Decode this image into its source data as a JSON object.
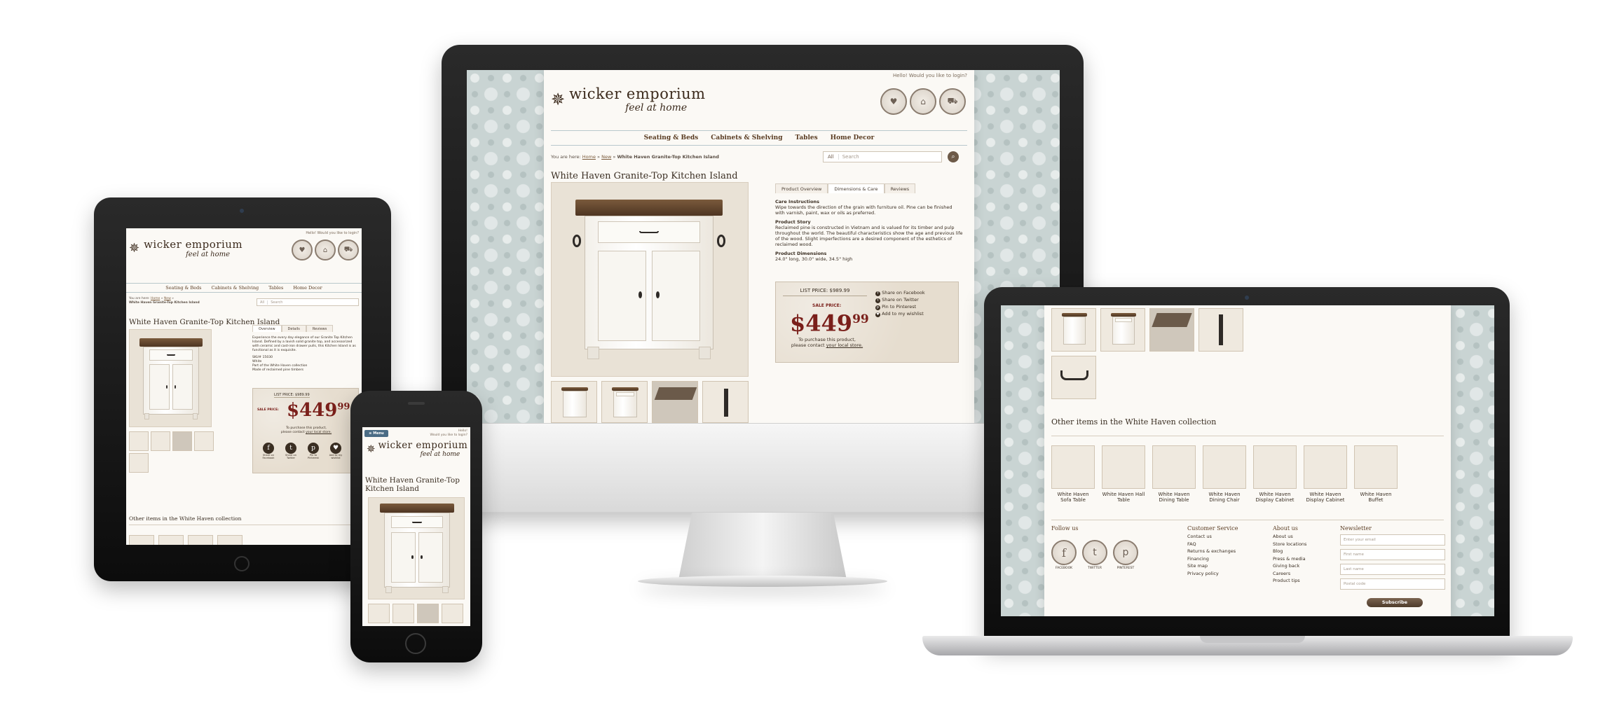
{
  "brand": {
    "name": "wicker emporium",
    "tagline": "feel at home",
    "greeting": "Hello! Would you like to login?"
  },
  "nav": [
    "Seating & Beds",
    "Cabinets & Shelving",
    "Tables",
    "Home Decor"
  ],
  "phone_menu_label": "Menu",
  "phone_greeting_line1": "Hello!",
  "phone_greeting_line2": "Would you like to login?",
  "breadcrumb": {
    "prefix": "You are here:",
    "home": "Home",
    "sep": "»",
    "new": "New",
    "current": "White Haven Granite-Top Kitchen Island"
  },
  "search": {
    "scope": "All",
    "placeholder": "Search"
  },
  "product": {
    "title": "White Haven Granite-Top Kitchen Island",
    "tabs": [
      "Product Overview",
      "Dimensions & Care",
      "Reviews"
    ],
    "tablet_tabs": [
      "Overview",
      "Details",
      "Reviews"
    ],
    "care_heading": "Care Instructions",
    "care_text": "Wipe towards the direction of the grain with furniture oil. Pine can be finished with varnish, paint, wax or oils as preferred.",
    "story_heading": "Product Story",
    "story_text": "Reclaimed pine is constructed in Vietnam and is valued for its timber and pulp throughout the world. The beautiful characteristics show the age and previous life of the wood. Slight imperfections are a desired component of the esthetics of reclaimed wood.",
    "dims_heading": "Product Dimensions",
    "dims_text": "24.0\" long, 30.0\" wide, 34.5\" high",
    "overview_text": "Experience the every day elegance of our Granite Top Kitchen Island. Defined by a lavish solid granite top, and accessorized with ceramic and cast-iron drawer pulls, this Kitchen Island is as functional as it is exquisite.",
    "sku": "SKU# 15030",
    "color": "White",
    "collection_note": "Part of the White Haven collection",
    "material": "Made of reclaimed pine timbers",
    "list_price_label": "LIST PRICE:",
    "list_price": "$989.99",
    "sale_label": "SALE PRICE:",
    "sale_dollars": "$449",
    "sale_cents": "99",
    "contact_line1": "To purchase this product,",
    "contact_line2": "please contact",
    "contact_link": "your local store.",
    "share": [
      "Share on Facebook",
      "Share on Twitter",
      "Pin to Pinterest",
      "Add to my wishlist"
    ],
    "share_short": [
      "Share on Facebook",
      "Share on Twitter",
      "Pin to Pinterest",
      "Add to my wishlist"
    ]
  },
  "collection": {
    "heading": "Other items in the White Haven collection",
    "items": [
      "White Haven Sofa Table",
      "White Haven Hall Table",
      "White Haven Dining Table",
      "White Haven Dining Chair",
      "White Haven Display Cabinet",
      "White Haven Display Cabinet",
      "White Haven Buffet"
    ]
  },
  "footer": {
    "follow_heading": "Follow us",
    "social": [
      "FACEBOOK",
      "TWITTER",
      "PINTEREST"
    ],
    "service_heading": "Customer Service",
    "service_links": [
      "Contact us",
      "FAQ",
      "Returns & exchanges",
      "Financing",
      "Site map",
      "Privacy policy"
    ],
    "about_heading": "About us",
    "about_links": [
      "About us",
      "Store locations",
      "Blog",
      "Press & media",
      "Giving back",
      "Careers",
      "Product tips"
    ],
    "newsletter_heading": "Newsletter",
    "newsletter_fields": [
      "Enter your email",
      "First name",
      "Last name",
      "Postal code"
    ],
    "subscribe_label": "Subscribe"
  },
  "colors": {
    "brand_brown": "#3b2a1c",
    "price_red": "#7a1f1a",
    "wallpaper": "#c9d4d3"
  }
}
